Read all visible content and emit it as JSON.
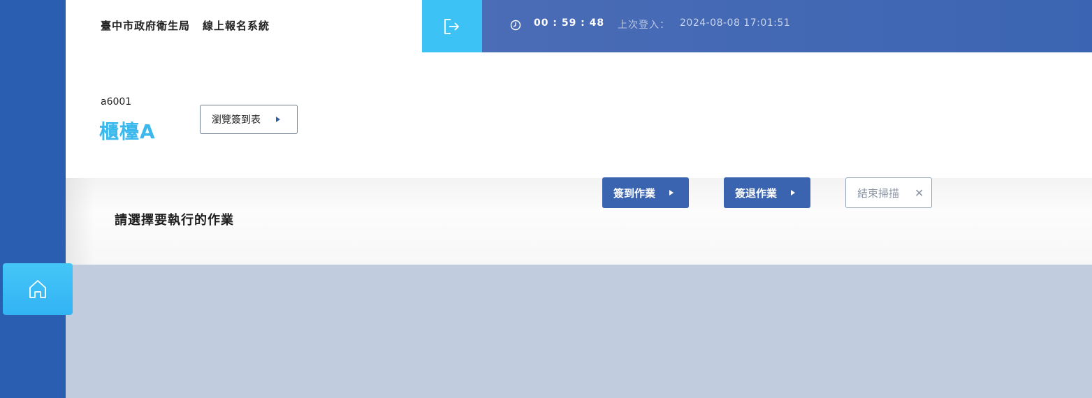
{
  "header": {
    "org_name": "臺中市政府衛生局",
    "system_name": "線上報名系統",
    "timer": "00 : 59 : 48",
    "last_login_label": "上次登入：",
    "last_login_value": "2024-08-08 17:01:51",
    "icons": {
      "logout": "logout-icon",
      "clock": "clock-icon"
    },
    "accent_color": "#3cc2f5",
    "bar_color": "#3b65b2"
  },
  "counter": {
    "account_id": "a6001",
    "name": "櫃檯A",
    "browse_button_label": "瀏覽簽到表"
  },
  "operations": {
    "prompt": "請選擇要執行的作業",
    "checkin_label": "簽到作業",
    "checkout_label": "簽退作業",
    "end_scan_label": "結束掃描"
  },
  "sidebar": {
    "home_icon": "home-icon"
  }
}
